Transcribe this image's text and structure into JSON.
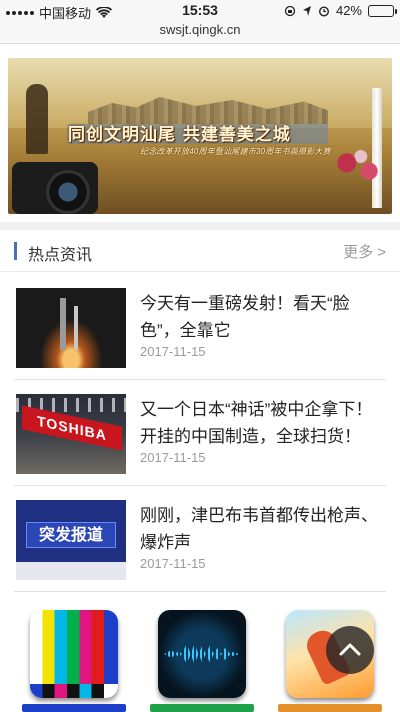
{
  "status_bar": {
    "carrier": "中国移动",
    "time": "15:53",
    "battery": "42%",
    "battery_level": 0.42
  },
  "browser": {
    "url": "swsjt.qingk.cn"
  },
  "banner": {
    "title": "同创文明汕尾   共建善美之城",
    "subtitle": "纪念改革开放40周年暨汕尾建市30周年书画摄影大赛"
  },
  "section": {
    "title": "热点资讯",
    "more": "更多 >"
  },
  "news": [
    {
      "headline": "今天有一重磅发射！看天“脸色”，全靠它",
      "date": "2017-11-15"
    },
    {
      "headline": "又一个日本“神话”被中企拿下！开挂的中国制造，全球扫货！",
      "date": "2017-11-15",
      "thumb_text": "TOSHIBA"
    },
    {
      "headline": "刚刚，津巴布韦首都传出枪声、爆炸声",
      "date": "2017-11-15",
      "thumb_text": "突发报道"
    }
  ],
  "apps": [
    {
      "icon": "tv-color-bars-icon",
      "base_color": "#1b3fc9"
    },
    {
      "icon": "sound-wave-icon",
      "base_color": "#1fa34a"
    },
    {
      "icon": "dancer-icon",
      "base_color": "#e5902a"
    }
  ],
  "colors": {
    "accent": "#4a6fb5",
    "muted": "#9a9a9a"
  }
}
